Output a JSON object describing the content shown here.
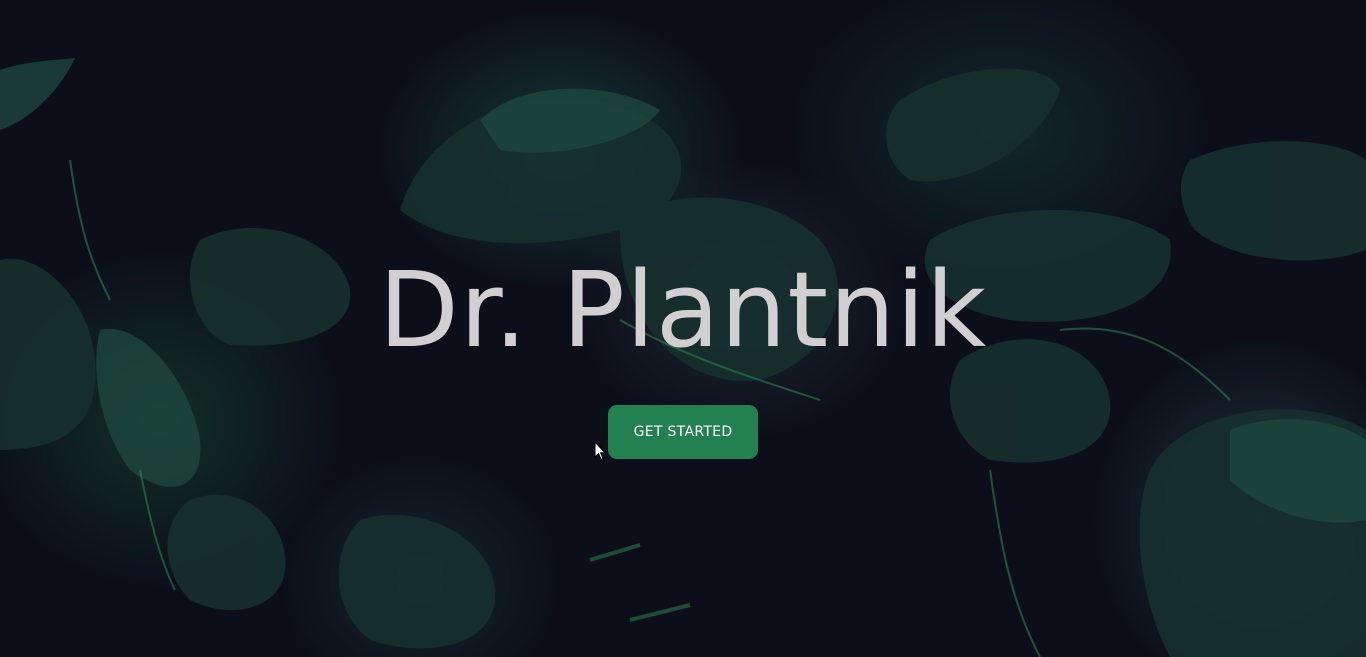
{
  "hero": {
    "title": "Dr. Plantnik",
    "cta_label": "GET STARTED"
  },
  "colors": {
    "background": "#0c0f1a",
    "title": "#d2cfd2",
    "button": "#238050",
    "leaf_dark": "#16302e",
    "leaf_mid": "#1e4a40",
    "leaf_bright": "#2f8a55"
  },
  "icons": {
    "cursor": "mouse-pointer-icon"
  }
}
